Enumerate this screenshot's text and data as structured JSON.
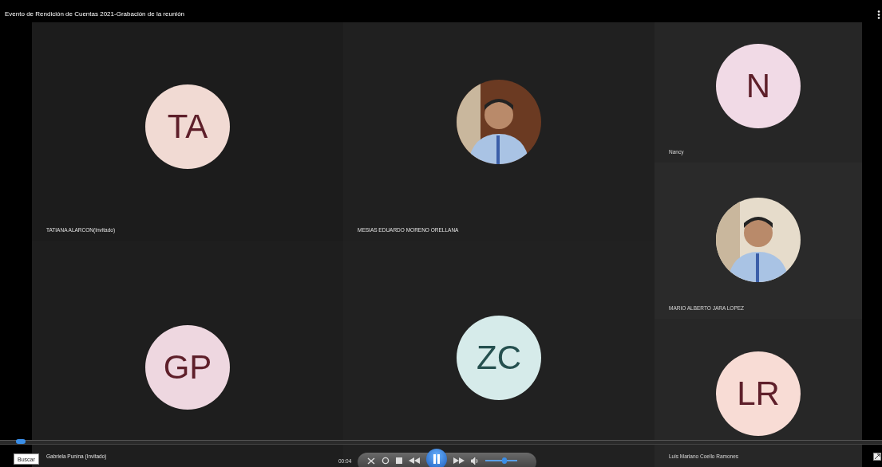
{
  "window": {
    "title": "Evento de Rendición de Cuentas 2021-Grabación de la reunión"
  },
  "main_tiles": [
    {
      "kind": "initials",
      "initials": "TA",
      "name": "TATIANA ALARCON(Invitado)",
      "color": "#f1dad3"
    },
    {
      "kind": "picture",
      "name": "MESIAS EDUARDO MORENO ORELLANA"
    },
    {
      "kind": "initials",
      "initials": "GP",
      "name": "Gabriela Punina (Invitado)",
      "color": "#eed7e0"
    },
    {
      "kind": "initials",
      "initials": "ZC",
      "color": "#d6ebea"
    }
  ],
  "side_tiles": [
    {
      "kind": "initials",
      "initials": "N",
      "name": "Nancy",
      "color": "#f1dae6"
    },
    {
      "kind": "picture",
      "name": "MARIO ALBERTO JARA LOPEZ"
    },
    {
      "kind": "initials",
      "initials": "LR",
      "name": "Luis Mariano Coello Ramones",
      "color": "#f8dcd5"
    }
  ],
  "player": {
    "search_button": "Buscar",
    "time": "00:04",
    "playing": true,
    "seek": {
      "level": 0.015
    },
    "volume": {
      "level": 0.6
    }
  }
}
